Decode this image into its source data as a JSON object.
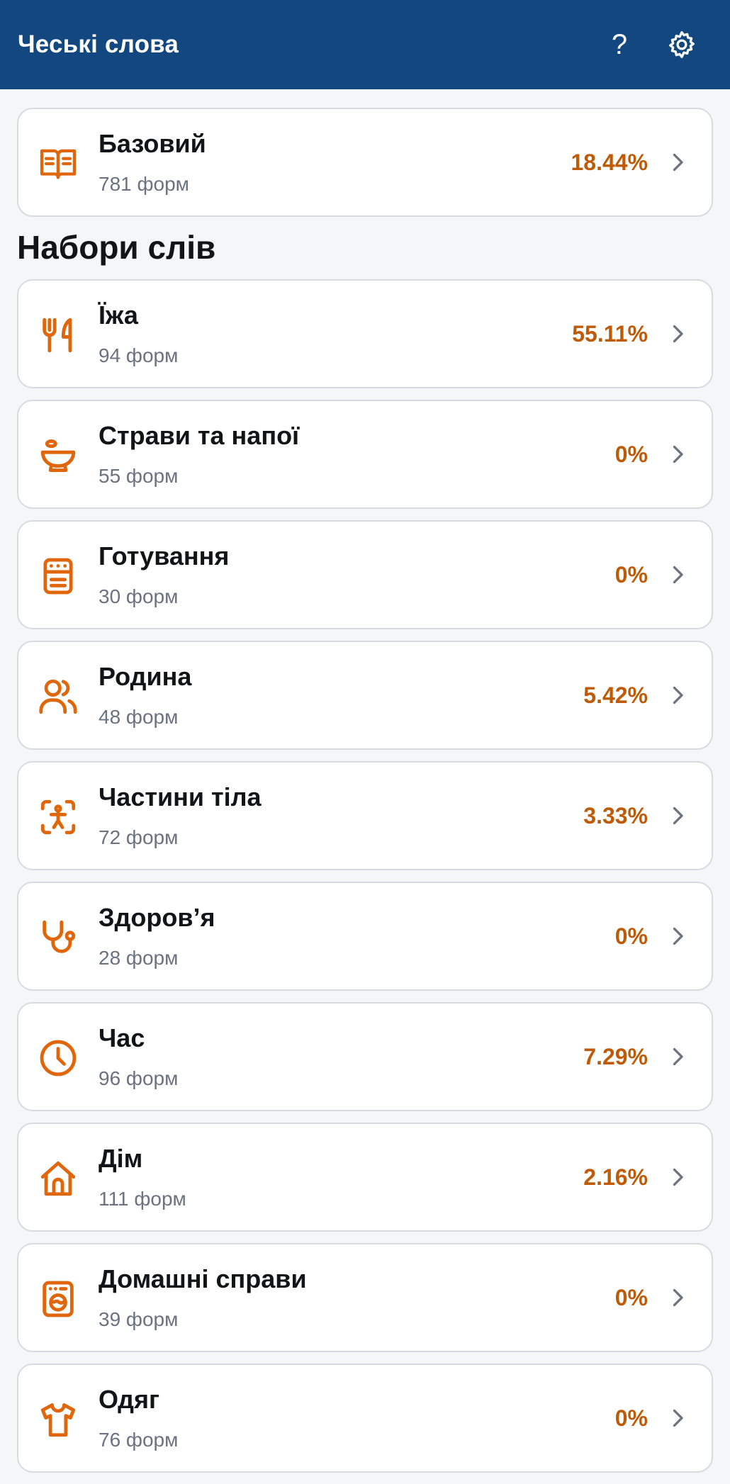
{
  "app": {
    "title": "Чеські слова"
  },
  "header": {
    "help_label": "?"
  },
  "base_set": {
    "icon": "book-icon",
    "title": "Базовий",
    "subtitle": "781 форм",
    "percent": "18.44%"
  },
  "section": {
    "title": "Набори слів"
  },
  "sets": [
    {
      "icon": "fork-knife-icon",
      "title": "Їжа",
      "subtitle": "94 форм",
      "percent": "55.11%"
    },
    {
      "icon": "bowl-icon",
      "title": "Страви та напої",
      "subtitle": "55 форм",
      "percent": "0%"
    },
    {
      "icon": "stove-icon",
      "title": "Готування",
      "subtitle": "30 форм",
      "percent": "0%"
    },
    {
      "icon": "users-icon",
      "title": "Родина",
      "subtitle": "48 форм",
      "percent": "5.42%"
    },
    {
      "icon": "body-scan-icon",
      "title": "Частини тіла",
      "subtitle": "72 форм",
      "percent": "3.33%"
    },
    {
      "icon": "stethoscope-icon",
      "title": "Здоров’я",
      "subtitle": "28 форм",
      "percent": "0%"
    },
    {
      "icon": "clock-icon",
      "title": "Час",
      "subtitle": "96 форм",
      "percent": "7.29%"
    },
    {
      "icon": "house-icon",
      "title": "Дім",
      "subtitle": "111 форм",
      "percent": "2.16%"
    },
    {
      "icon": "washing-machine-icon",
      "title": "Домашні справи",
      "subtitle": "39 форм",
      "percent": "0%"
    },
    {
      "icon": "shirt-icon",
      "title": "Одяг",
      "subtitle": "76 форм",
      "percent": "0%"
    }
  ],
  "colors": {
    "appbar": "#12477f",
    "accent": "#e0660b",
    "percent": "#bf5a06"
  }
}
